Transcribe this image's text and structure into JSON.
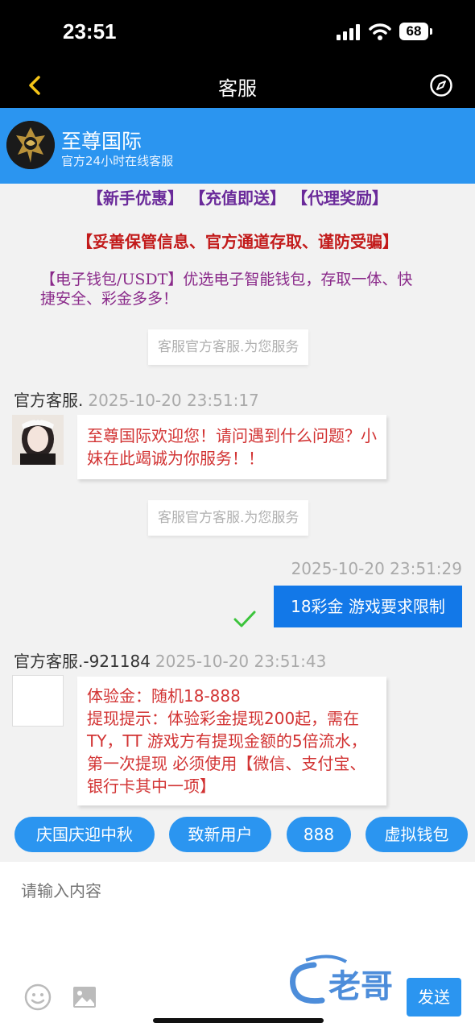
{
  "status_bar": {
    "time": "23:51",
    "battery": "68"
  },
  "nav": {
    "title": "客服"
  },
  "header": {
    "brand_name": "至尊国际",
    "subtitle": "官方24小时在线客服"
  },
  "promo": {
    "line1": "【新手优惠】 【充值即送】 【代理奖励】",
    "line2": "【妥善保管信息、官方通道存取、谨防受骗】",
    "line3": "【电子钱包/USDT】优选电子智能钱包，存取一体、快捷安全、彩金多多！"
  },
  "messages": {
    "notice1": "客服官方客服.为您服务",
    "sender1": "官方客服.",
    "time1": "2025-10-20 23:51:17",
    "bubble1": "至尊国际欢迎您！请问遇到什么问题？小妹在此竭诚为你服务！！",
    "notice2": "客服官方客服.为您服务",
    "time_out": "2025-10-20 23:51:29",
    "bubble_out": "18彩金 游戏要求限制",
    "sender2": "官方客服.-921184",
    "time2": "2025-10-20 23:51:43",
    "bubble2_line1": "体验金：随机18-888",
    "bubble2_line2": "提现提示：体验彩金提现200起，需在 TY，TT 游戏方有提现金额的5倍流水，第一次提现 必须使用【微信、支付宝、银行卡其中一项】"
  },
  "quick_replies": [
    "庆国庆迎中秋",
    "致新用户",
    "888",
    "虚拟钱包"
  ],
  "input": {
    "placeholder": "请输入内容"
  },
  "send_label": "发送",
  "watermark_text": "老哥",
  "colors": {
    "accent": "#2b95f0",
    "send_bubble": "#1278e8",
    "incoming_text": "#d23333"
  }
}
